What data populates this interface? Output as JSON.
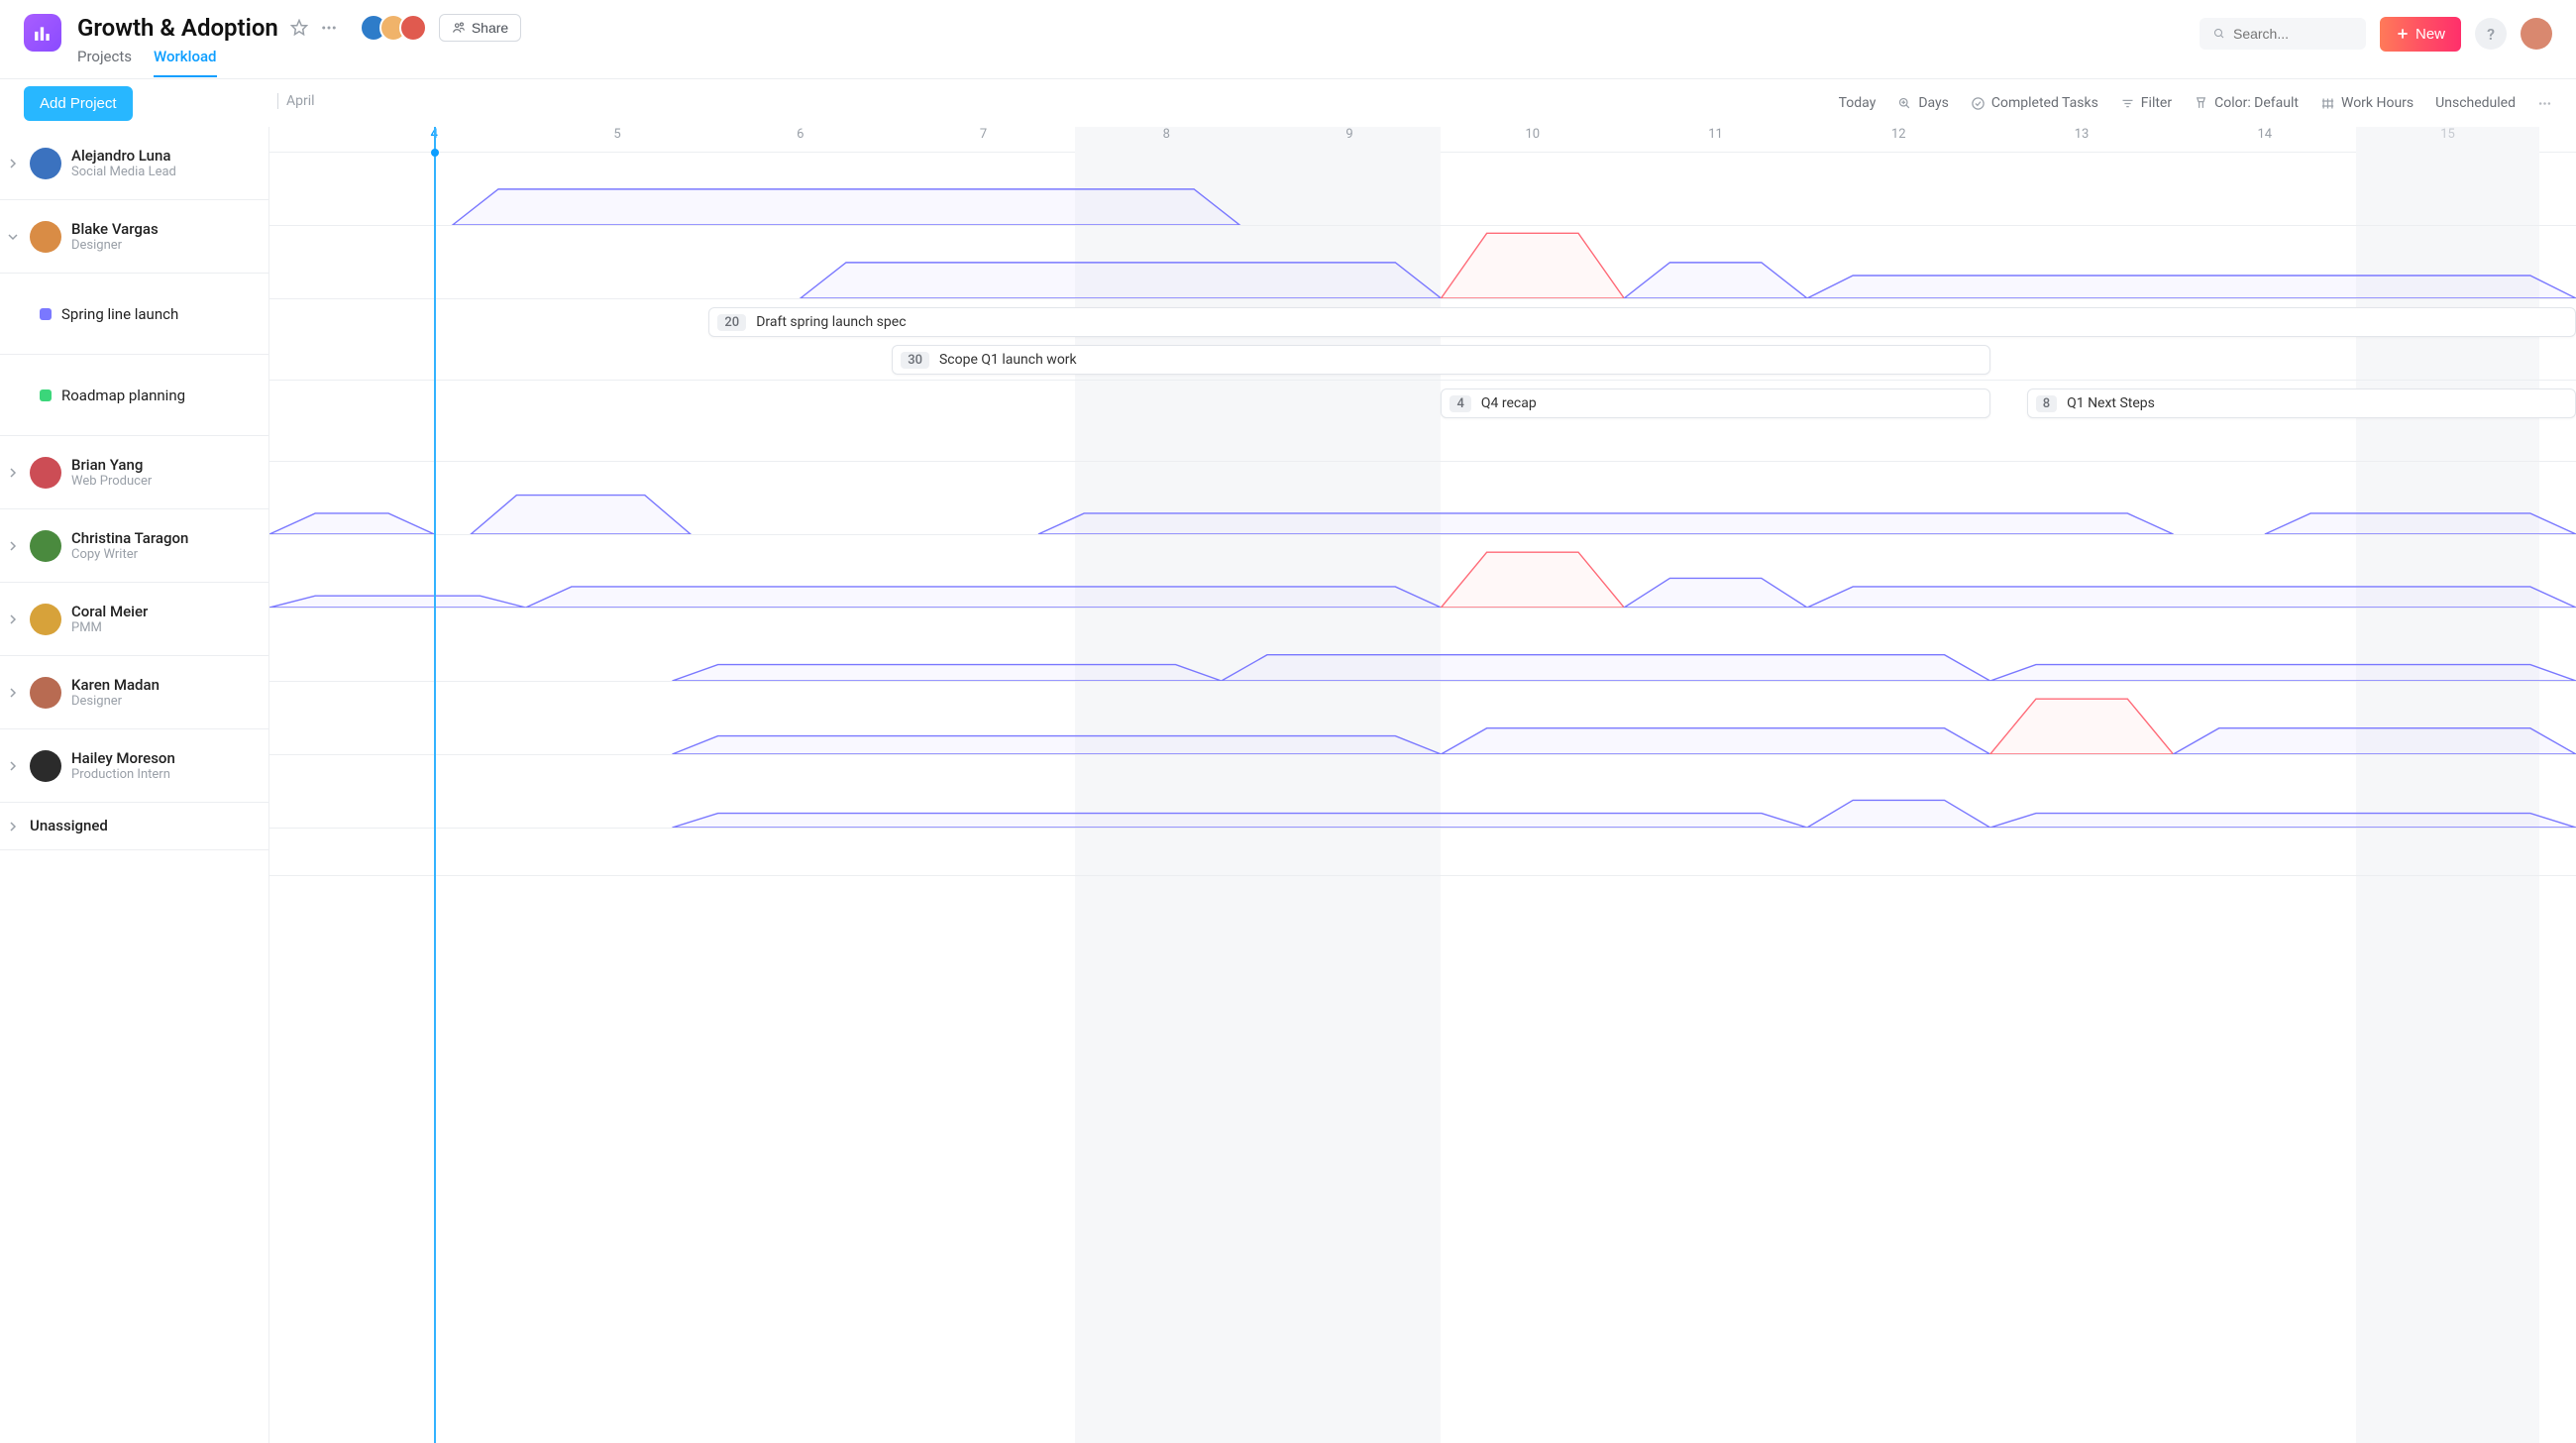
{
  "header": {
    "title": "Growth & Adoption",
    "tabs": [
      {
        "label": "Projects",
        "active": false
      },
      {
        "label": "Workload",
        "active": true
      }
    ],
    "share_label": "Share",
    "search_placeholder": "Search...",
    "new_label": "New",
    "collaborator_colors": [
      "#2e7cc9",
      "#f0b36a",
      "#e05a4f"
    ],
    "me_color": "#d9886f"
  },
  "toolbar": {
    "add_project_label": "Add Project",
    "month_label": "April",
    "items": {
      "today": "Today",
      "days": "Days",
      "completed": "Completed Tasks",
      "filter": "Filter",
      "color": "Color: Default",
      "hours": "Work Hours",
      "unscheduled": "Unscheduled"
    }
  },
  "timeline": {
    "days": [
      "4",
      "5",
      "6",
      "7",
      "8",
      "9",
      "10",
      "11",
      "12",
      "13",
      "14",
      "15"
    ],
    "current_index": 0,
    "weekend_indices": [
      [
        4,
        5
      ],
      [
        11,
        11
      ]
    ]
  },
  "lanes": [
    {
      "type": "person",
      "name": "Alejandro Luna",
      "role": "Social Media Lead",
      "expanded": false,
      "avatar": "#3b72bf",
      "curve": {
        "segments": [
          {
            "from": 0.6,
            "to": 4.9,
            "level": 0.55,
            "over": false
          }
        ]
      }
    },
    {
      "type": "person",
      "name": "Blake Vargas",
      "role": "Designer",
      "expanded": true,
      "avatar": "#d98c45",
      "curve": {
        "segments": [
          {
            "from": 2.5,
            "to": 6.0,
            "level": 0.55,
            "over": false
          },
          {
            "from": 6.0,
            "to": 7.0,
            "level": 1.0,
            "over": true
          },
          {
            "from": 7.0,
            "to": 8.0,
            "level": 0.55,
            "over": false
          },
          {
            "from": 8.0,
            "to": 12.2,
            "level": 0.35,
            "over": false
          }
        ]
      }
    },
    {
      "type": "project",
      "name": "Spring line launch",
      "chip": "#7a78ff",
      "tasks": [
        {
          "badge": "20",
          "label": "Draft spring launch spec",
          "start": 2.0,
          "end": 12.2,
          "row": 0
        },
        {
          "badge": "30",
          "label": "Scope Q1 launch work",
          "start": 3.0,
          "end": 9.0,
          "row": 1
        }
      ]
    },
    {
      "type": "project",
      "name": "Roadmap planning",
      "chip": "#3bd67a",
      "tasks": [
        {
          "badge": "4",
          "label": "Q4 recap",
          "start": 6.0,
          "end": 9.0,
          "row": 0
        },
        {
          "badge": "8",
          "label": "Q1 Next Steps",
          "start": 9.2,
          "end": 12.2,
          "row": 0
        }
      ]
    },
    {
      "type": "person",
      "name": "Brian Yang",
      "role": "Web Producer",
      "expanded": false,
      "avatar": "#cc4d55",
      "curve": {
        "segments": [
          {
            "from": -0.4,
            "to": 0.5,
            "level": 0.32,
            "over": false
          },
          {
            "from": 0.7,
            "to": 1.9,
            "level": 0.6,
            "over": false
          },
          {
            "from": 3.8,
            "to": 10.0,
            "level": 0.32,
            "over": false
          },
          {
            "from": 10.5,
            "to": 12.2,
            "level": 0.32,
            "over": false
          }
        ]
      }
    },
    {
      "type": "person",
      "name": "Christina Taragon",
      "role": "Copy Writer",
      "expanded": false,
      "avatar": "#4a8a3e",
      "curve": {
        "segments": [
          {
            "from": -0.4,
            "to": 1.0,
            "level": 0.18,
            "over": false
          },
          {
            "from": 1.0,
            "to": 6.0,
            "level": 0.32,
            "over": false
          },
          {
            "from": 6.0,
            "to": 7.0,
            "level": 0.85,
            "over": true
          },
          {
            "from": 7.0,
            "to": 8.0,
            "level": 0.45,
            "over": false
          },
          {
            "from": 8.0,
            "to": 12.2,
            "level": 0.32,
            "over": false
          }
        ]
      }
    },
    {
      "type": "person",
      "name": "Coral Meier",
      "role": "PMM",
      "expanded": false,
      "avatar": "#d7a23a",
      "curve": {
        "segments": [
          {
            "from": 1.8,
            "to": 4.8,
            "level": 0.25,
            "over": false
          },
          {
            "from": 4.8,
            "to": 9.0,
            "level": 0.4,
            "over": false
          },
          {
            "from": 9.0,
            "to": 12.2,
            "level": 0.25,
            "over": false
          }
        ]
      }
    },
    {
      "type": "person",
      "name": "Karen Madan",
      "role": "Designer",
      "expanded": false,
      "avatar": "#b86b52",
      "curve": {
        "segments": [
          {
            "from": 1.8,
            "to": 6.0,
            "level": 0.28,
            "over": false
          },
          {
            "from": 6.0,
            "to": 9.0,
            "level": 0.4,
            "over": false
          },
          {
            "from": 9.0,
            "to": 10.0,
            "level": 0.85,
            "over": true
          },
          {
            "from": 10.0,
            "to": 12.2,
            "level": 0.4,
            "over": false
          }
        ]
      }
    },
    {
      "type": "person",
      "name": "Hailey Moreson",
      "role": "Production Intern",
      "expanded": false,
      "avatar": "#2b2b2b",
      "curve": {
        "segments": [
          {
            "from": 1.8,
            "to": 8.0,
            "level": 0.22,
            "over": false
          },
          {
            "from": 8.0,
            "to": 9.0,
            "level": 0.42,
            "over": false
          },
          {
            "from": 9.0,
            "to": 12.2,
            "level": 0.22,
            "over": false
          }
        ]
      }
    },
    {
      "type": "unassigned",
      "name": "Unassigned"
    }
  ]
}
